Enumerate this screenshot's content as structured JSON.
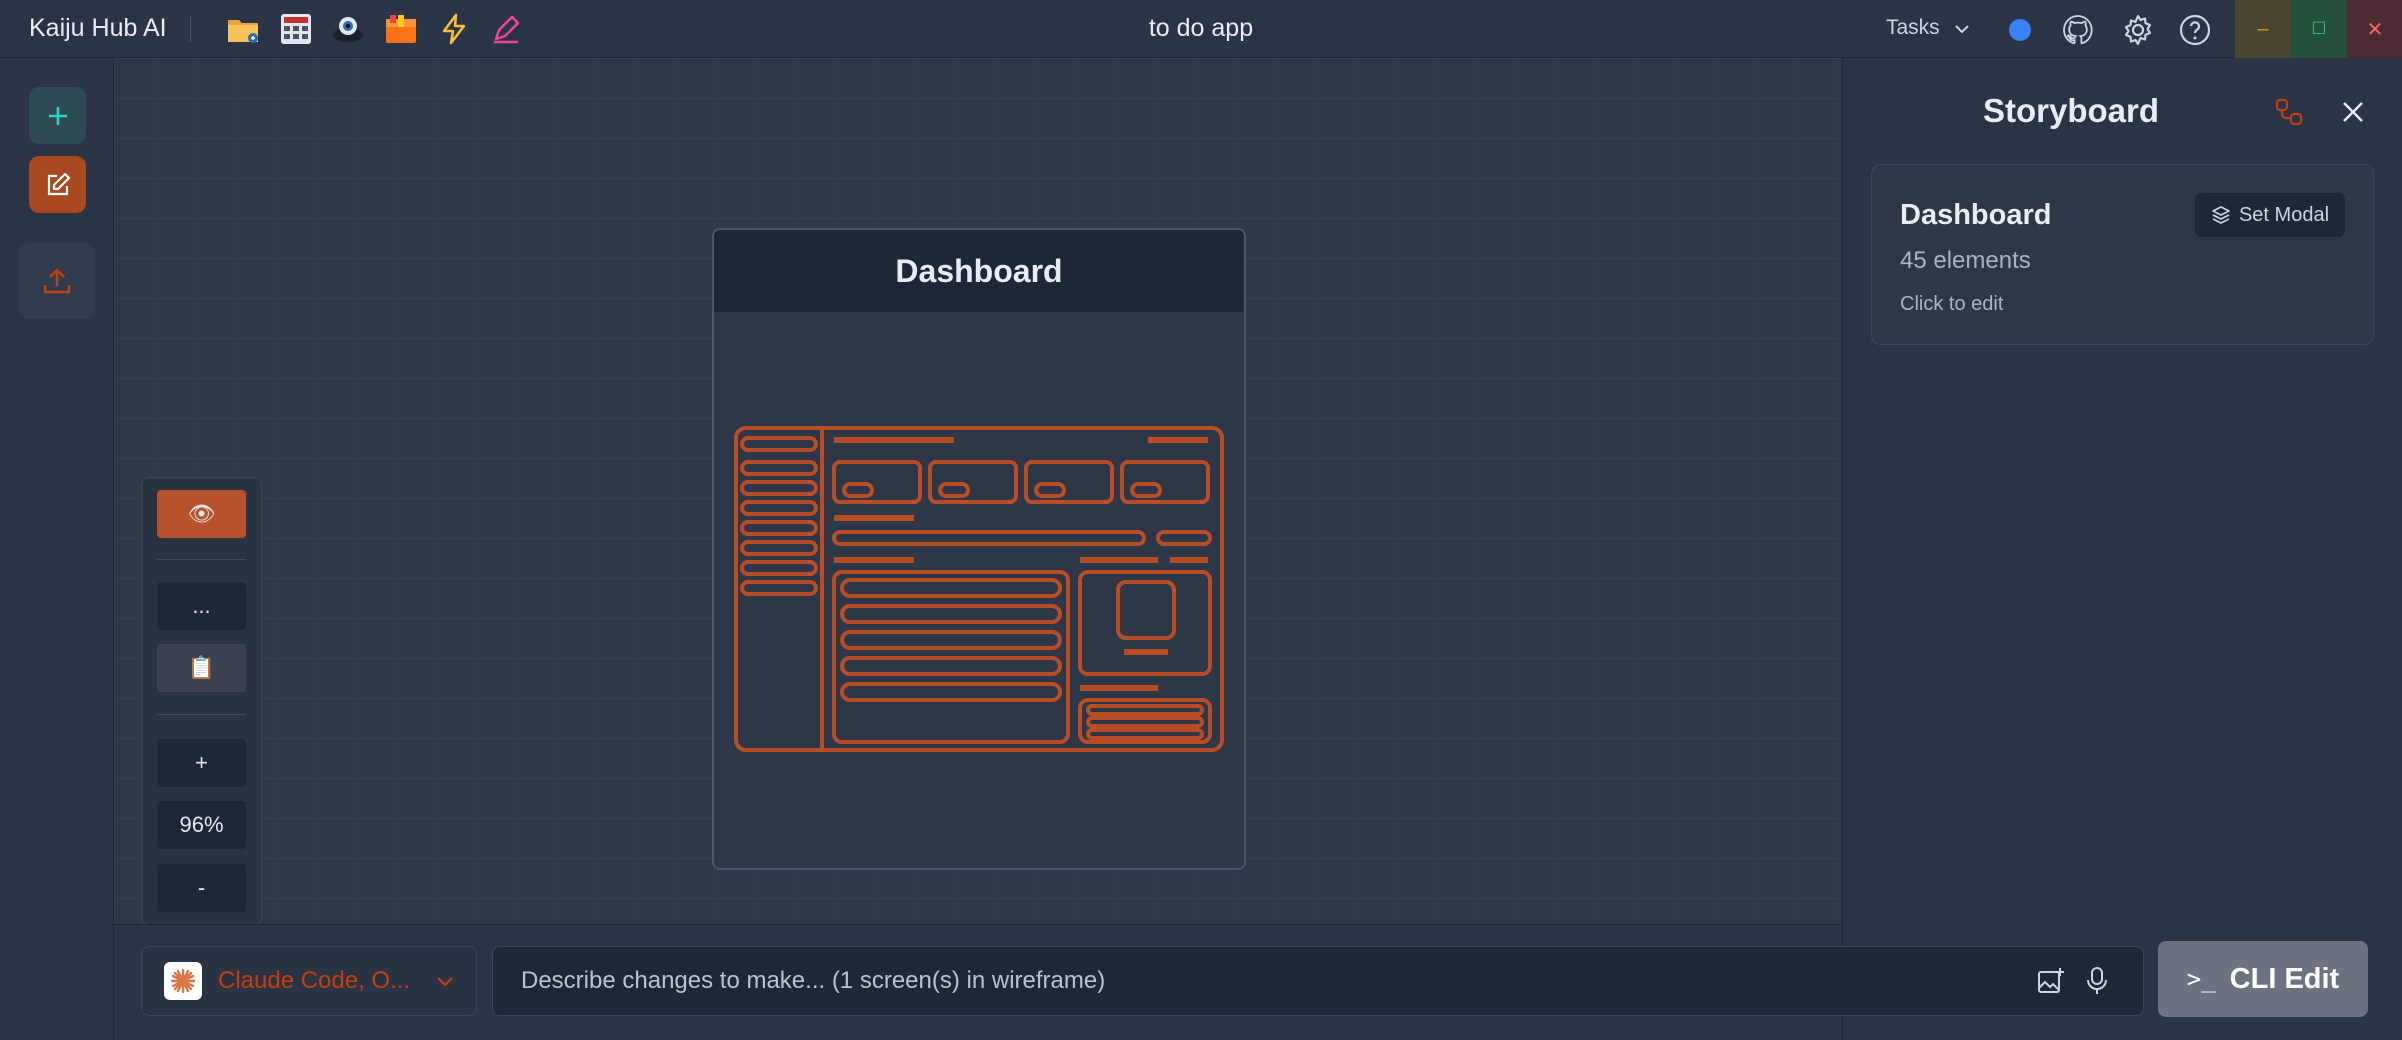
{
  "app": {
    "name": "Kaiju Hub AI",
    "window_title": "to do app"
  },
  "toolbar": {
    "icons": [
      "folder-icon",
      "grid-app-icon",
      "eye-robot-icon",
      "package-icon",
      "lightning-icon",
      "pen-icon"
    ],
    "tasks_label": "Tasks"
  },
  "colors": {
    "accent": "#c2410c",
    "accent_button": "#a9491f",
    "teal": "#2dd4bf",
    "cli_button": "#6b7280",
    "status_dot": "#3b82f6"
  },
  "canvas": {
    "screen_title": "Dashboard",
    "zoom_tools": {
      "preview_label": "👁",
      "more_label": "...",
      "notes_label": "📋",
      "zoom_in": "+",
      "zoom_level": "96%",
      "zoom_out": "-"
    }
  },
  "storyboard": {
    "title": "Storyboard",
    "card": {
      "name": "Dashboard",
      "count": "45 elements",
      "hint": "Click to edit",
      "set_modal_label": "Set Modal"
    }
  },
  "bottom": {
    "model_label": "Claude Code, O...",
    "prompt_placeholder": "Describe changes to make... (1 screen(s) in wireframe)",
    "cli_label": "CLI Edit",
    "cli_glyph": ">_"
  }
}
